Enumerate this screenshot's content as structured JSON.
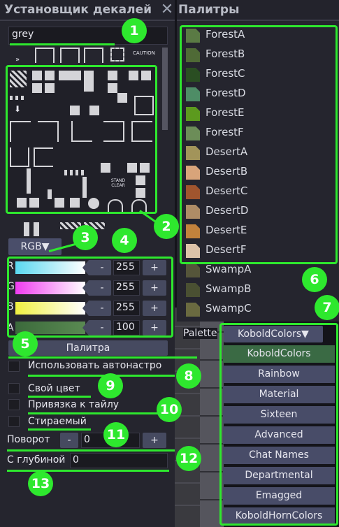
{
  "decal_placer": {
    "title": "Установщик декалей",
    "search_value": "grey",
    "caution_text": "CAUTION",
    "stand_clear_text": "STAND CLEAR",
    "color_mode": "RGB▼",
    "channels": [
      {
        "label": "R",
        "value": "255",
        "minus": "-",
        "plus": "+"
      },
      {
        "label": "G",
        "value": "255",
        "minus": "-",
        "plus": "+"
      },
      {
        "label": "B",
        "value": "255",
        "minus": "-",
        "plus": "+"
      },
      {
        "label": "A",
        "value": "100",
        "minus": "-",
        "plus": "+"
      }
    ],
    "palette_button": "Палитра",
    "auto_settings": "Использовать автонастро",
    "custom_color": "Свой цвет",
    "snap_to_tile": "Привязка к тайлу",
    "cleanable": "Стираемый",
    "rotation_label": "Поворот",
    "rotation_minus": "-",
    "rotation_value": "0",
    "rotation_plus": "+",
    "depth_label": "С глубиной",
    "depth_value": "0"
  },
  "palettes": {
    "title": "Палитры",
    "items": [
      {
        "name": "ForestA",
        "color": "#5a7a44"
      },
      {
        "name": "ForestB",
        "color": "#4f6a36"
      },
      {
        "name": "ForestC",
        "color": "#2a4e22"
      },
      {
        "name": "ForestD",
        "color": "#4e8d66"
      },
      {
        "name": "ForestE",
        "color": "#5c9a1e"
      },
      {
        "name": "ForestF",
        "color": "#6c8d58"
      },
      {
        "name": "DesertA",
        "color": "#a2945a"
      },
      {
        "name": "DesertB",
        "color": "#d8a47a"
      },
      {
        "name": "DesertC",
        "color": "#a0552e"
      },
      {
        "name": "DesertD",
        "color": "#ae8c66"
      },
      {
        "name": "DesertE",
        "color": "#c2823c"
      },
      {
        "name": "DesertF",
        "color": "#dcc2a8"
      },
      {
        "name": "SwampA",
        "color": "#55553a"
      },
      {
        "name": "SwampB",
        "color": "#4a5032"
      },
      {
        "name": "SwampC",
        "color": "#6a6a40"
      }
    ],
    "palette_label": "Palette",
    "selected": "KoboldColors▼",
    "options": [
      "KoboldColors",
      "Rainbow",
      "Material",
      "Sixteen",
      "Advanced",
      "Chat Names",
      "Departmental",
      "Emagged",
      "KoboldHornColors"
    ]
  },
  "annotations": [
    "1",
    "2",
    "3",
    "4",
    "5",
    "6",
    "7",
    "8",
    "9",
    "10",
    "11",
    "12",
    "13"
  ],
  "colors": {
    "accent": "#2ee82e",
    "button": "#464a60",
    "panel": "#25252e"
  }
}
